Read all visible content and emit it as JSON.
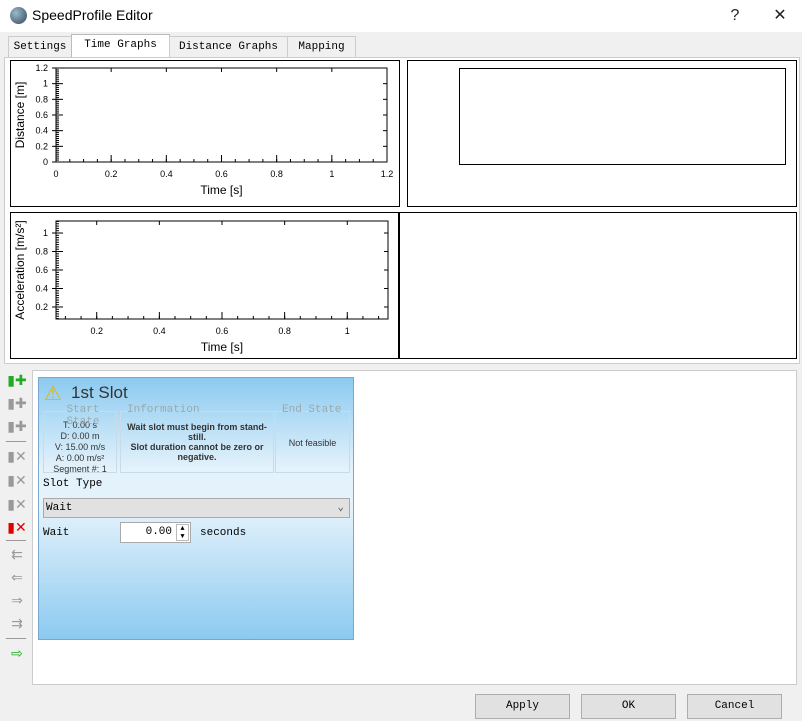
{
  "window": {
    "title": "SpeedProfile Editor",
    "help": "?",
    "close": "✕"
  },
  "tabs": [
    {
      "label": "Settings"
    },
    {
      "label": "Time Graphs"
    },
    {
      "label": "Distance Graphs"
    },
    {
      "label": "Mapping"
    }
  ],
  "chart_data": [
    {
      "type": "line",
      "xlabel": "Time [s]",
      "ylabel": "Distance [m]",
      "xlim": [
        0,
        1.2
      ],
      "ylim": [
        0,
        1.2
      ],
      "xticks": [
        "0",
        "0.2",
        "0.4",
        "0.6",
        "0.8",
        "1",
        "1.2"
      ],
      "yticks": [
        "0",
        "0.2",
        "0.4",
        "0.6",
        "0.8",
        "1",
        "1.2"
      ],
      "series": []
    },
    {
      "type": "line",
      "xlabel": "Time [s]",
      "ylabel": "Acceleration [m/s²]",
      "xlim": [
        0.07,
        1.13
      ],
      "ylim": [
        0.07,
        1.13
      ],
      "xticks": [
        "0.2",
        "0.4",
        "0.6",
        "0.8",
        "1"
      ],
      "yticks": [
        "0.2",
        "0.4",
        "0.6",
        "0.8",
        "1"
      ],
      "series": []
    }
  ],
  "slot": {
    "title": "1st Slot",
    "icon": "warning-icon",
    "start_legend": "Start State",
    "start": {
      "t": "T: 0.00 s",
      "d": "D: 0.00 m",
      "v": "V: 15.00 m/s",
      "a": "A: 0.00 m/s²",
      "seg": "Segment #: 1"
    },
    "info_legend": "Information",
    "info": "Wait slot must begin from stand-still.\nSlot duration cannot be zero or negative.",
    "end_legend": "End State",
    "end": "Not feasible",
    "type_label": "Slot Type",
    "type_value": "Wait",
    "wait_label": "Wait",
    "wait_value": "0.00",
    "wait_unit": "seconds"
  },
  "buttons": {
    "apply": "Apply",
    "ok": "OK",
    "cancel": "Cancel"
  }
}
